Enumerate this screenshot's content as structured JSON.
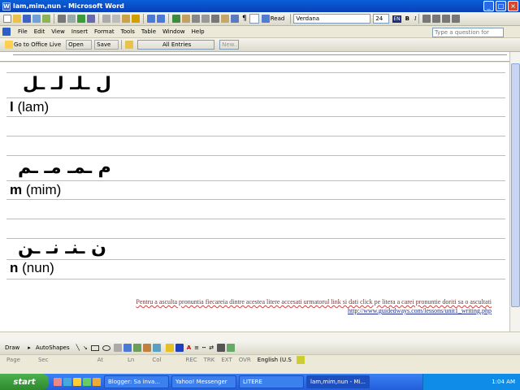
{
  "window": {
    "title": "lam,mim,nun - Microsoft Word"
  },
  "toolbar": {
    "read_label": "Read",
    "font": "Verdana",
    "size": "24",
    "lang": "EN"
  },
  "menu": [
    "File",
    "Edit",
    "View",
    "Insert",
    "Format",
    "Tools",
    "Table",
    "Window",
    "Help"
  ],
  "help_placeholder": "Type a question for help",
  "toolbar2": {
    "office_live": "Go to Office Live",
    "open": "Open",
    "save": "Save",
    "all_entries": "All Entries",
    "new": "New..."
  },
  "document": {
    "rows": [
      {
        "arabic": "ل ـلـ لـ ـل",
        "latin_bold": "l",
        "latin_rest": "(lam)"
      },
      {
        "arabic": "م ـمـ مـ ـم",
        "latin_bold": "m",
        "latin_rest": "(mim)"
      },
      {
        "arabic": "ن ـنـ نـ ـن",
        "latin_bold": "n",
        "latin_rest": "(nun)"
      }
    ],
    "note": "Pentru a asculta pronuntia fiecareia dintre acestea litere accesati urmatorul link si dati click pe litera a carei pronuntie doriti sa o ascultati",
    "link": "http://www.guidedways.com/lessons/unit1_writing.php"
  },
  "drawbar": {
    "draw": "Draw",
    "autoshapes": "AutoShapes"
  },
  "status": [
    "Page",
    "Sec",
    "At",
    "Ln",
    "Col",
    "REC",
    "TRK",
    "EXT",
    "OVR",
    "English (U.S"
  ],
  "taskbar": {
    "start": "start",
    "tasks": [
      "Blogger: Sa inva...",
      "Yahoo! Messenger",
      "LITERE",
      "lam,mim,nun - Mi..."
    ],
    "clock": "1:04 AM"
  }
}
